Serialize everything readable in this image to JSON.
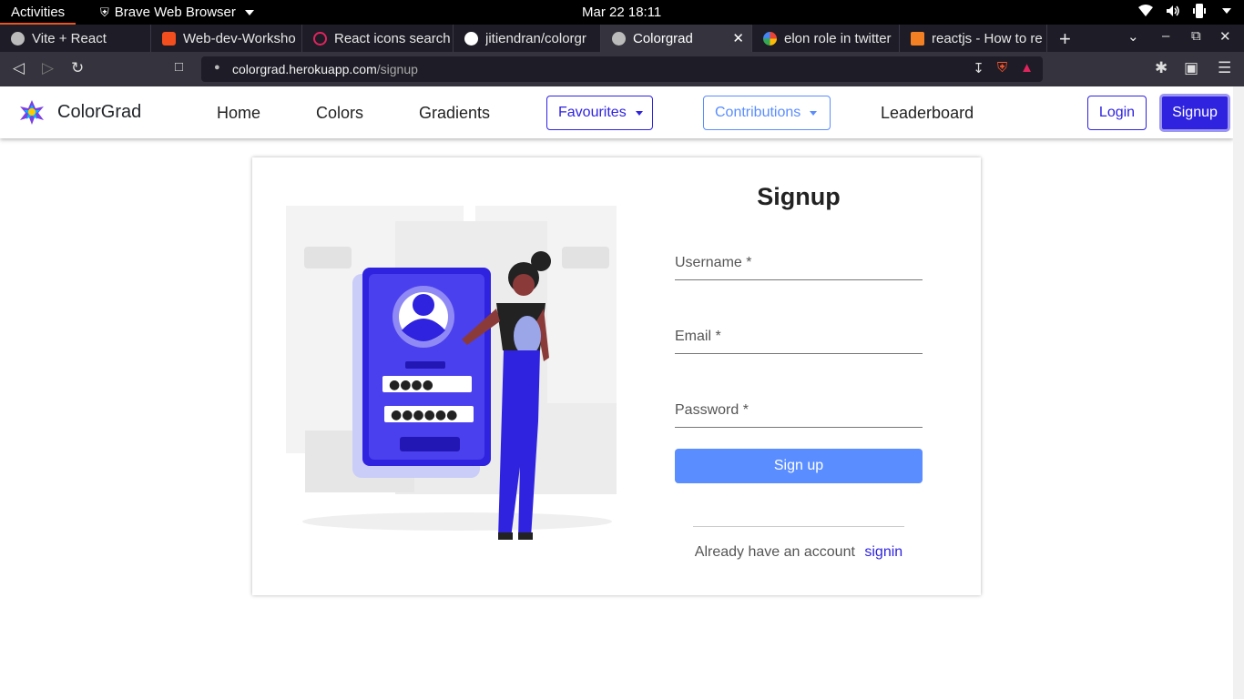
{
  "os": {
    "activities": "Activities",
    "app_name": "Brave Web Browser",
    "clock": "Mar 22  18:11"
  },
  "tabs": [
    {
      "label": "Vite + React",
      "icon_color": "#bbbbbb"
    },
    {
      "label": "Web-dev-Worksho",
      "icon_color": "#f24e1e"
    },
    {
      "label": "React icons search",
      "icon_color": "#e0245e"
    },
    {
      "label": "jitiendran/colorgr",
      "icon_color": "#ffffff"
    },
    {
      "label": "Colorgrad",
      "icon_color": "#bbbbbb",
      "active": true
    },
    {
      "label": "elon role in twitter",
      "icon_color": "#4285f4"
    },
    {
      "label": "reactjs - How to re",
      "icon_color": "#f48024"
    }
  ],
  "address": {
    "host": "colorgrad.herokuapp.com",
    "path": "/signup"
  },
  "site": {
    "brand": "ColorGrad",
    "nav": {
      "home": "Home",
      "colors": "Colors",
      "gradients": "Gradients",
      "favourites": "Favourites",
      "contributions": "Contributions",
      "leaderboard": "Leaderboard",
      "login": "Login",
      "signup": "Signup"
    },
    "colors": {
      "primary": "#2f23e0",
      "secondary": "#5a8dff"
    }
  },
  "form": {
    "title": "Signup",
    "username_placeholder": "Username *",
    "email_placeholder": "Email *",
    "password_placeholder": "Password *",
    "submit_label": "Sign up",
    "already_text": "Already have an account",
    "signin_link": "signin"
  }
}
